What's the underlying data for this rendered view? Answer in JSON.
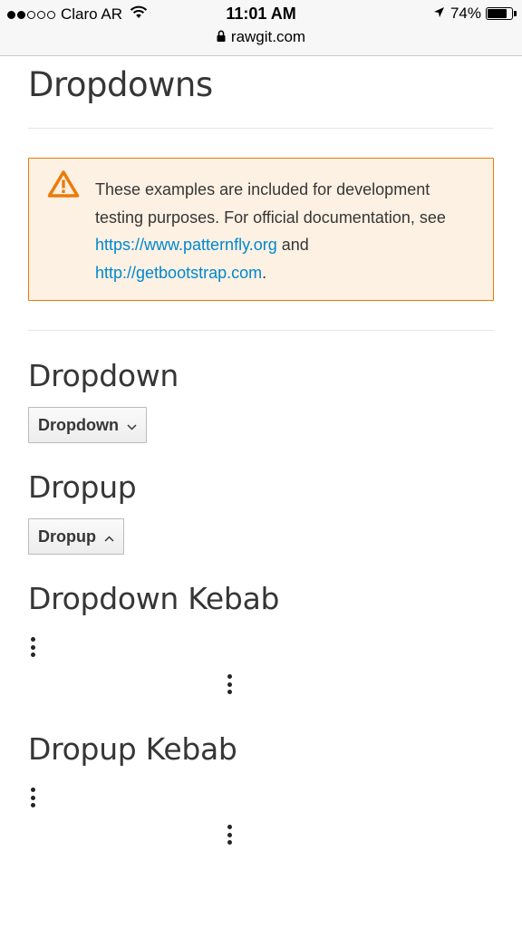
{
  "status_bar": {
    "carrier": "Claro AR",
    "time": "11:01 AM",
    "battery": "74%",
    "battery_level": 0.74,
    "signal_icon": "signal-dots-icon",
    "wifi_icon": "wifi-icon",
    "location_icon": "location-arrow-icon",
    "battery_icon": "battery-icon"
  },
  "browser": {
    "url": "rawgit.com",
    "lock_icon": "lock-icon"
  },
  "page": {
    "title": "Dropdowns",
    "alert": {
      "icon": "warning-triangle-icon",
      "text_before": "These examples are included for development testing purposes. For official documentation, see ",
      "link1": "https://www.patternfly.org",
      "text_middle": " and ",
      "link2": "http://getbootstrap.com",
      "text_after": ".",
      "colors": {
        "background": "#fdf1e3",
        "border": "#ec7a08",
        "link": "#0088ce"
      }
    },
    "sections": {
      "dropdown": {
        "heading": "Dropdown",
        "button_label": "Dropdown",
        "caret_icon": "chevron-down-icon"
      },
      "dropup": {
        "heading": "Dropup",
        "button_label": "Dropup",
        "caret_icon": "chevron-up-icon"
      },
      "dropdown_kebab": {
        "heading": "Dropdown Kebab",
        "kebab_icon": "kebab-vertical-icon"
      },
      "dropup_kebab": {
        "heading": "Dropup Kebab",
        "kebab_icon": "kebab-vertical-icon"
      }
    }
  }
}
